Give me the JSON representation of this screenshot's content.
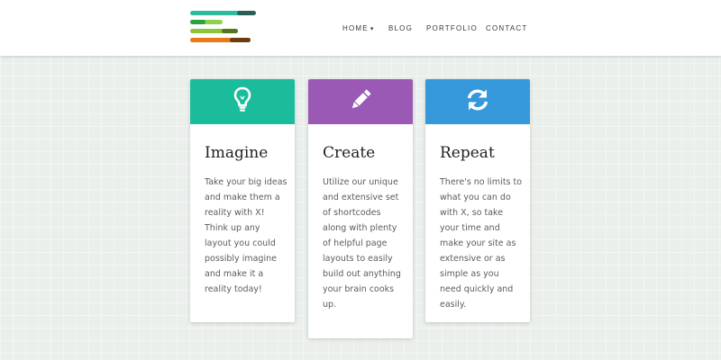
{
  "header": {
    "logo_bars": [
      {
        "color": "#2ebb9f",
        "accent": "#2a5f59"
      },
      {
        "color": "#8fd14b",
        "accent": "#27a343"
      },
      {
        "color": "#8cc43a",
        "accent": "#557520"
      },
      {
        "color": "#e8781a",
        "accent": "#6c3b12"
      }
    ],
    "nav": [
      {
        "label": "HOME",
        "has_dropdown": true,
        "chevron": "▾"
      },
      {
        "label": "BLOG"
      },
      {
        "label": "PORTFOLIO"
      },
      {
        "label": "CONTACT"
      }
    ]
  },
  "cards": [
    {
      "icon": "lightbulb-icon",
      "color": "#1abc9c",
      "title": "Imagine",
      "text": "Take your big ideas and make them a reality with X! Think up any layout you could possibly imagine and make it a reality today!"
    },
    {
      "icon": "pencil-icon",
      "color": "#9b59b6",
      "title": "Create",
      "text": "Utilize our unique and extensive set of shortcodes along with plenty of helpful page layouts to easily build out anything your brain cooks up."
    },
    {
      "icon": "refresh-icon",
      "color": "#3498db",
      "title": "Repeat",
      "text": "There's no limits to what you can do with X, so take your time and make your site as extensive or as simple as you need quickly and easily."
    }
  ]
}
